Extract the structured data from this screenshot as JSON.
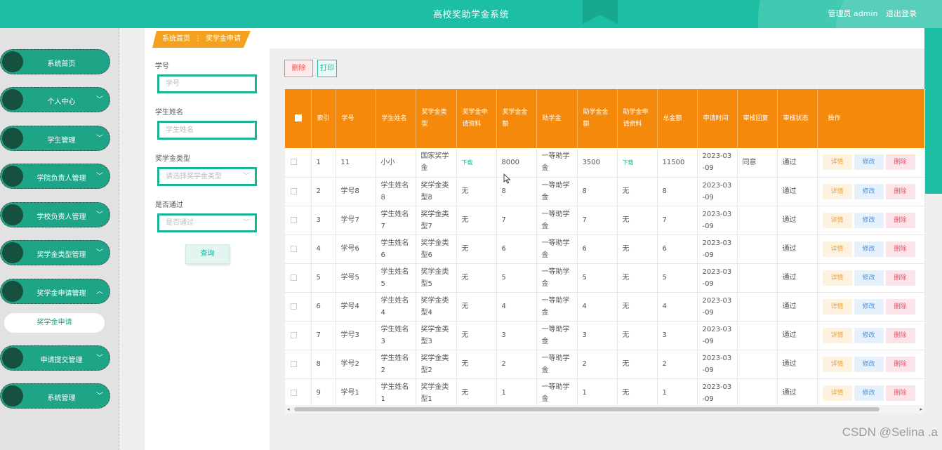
{
  "header": {
    "title": "高校奖助学金系统",
    "user": "管理员 admin",
    "logout": "退出登录"
  },
  "sidebar": {
    "items": [
      {
        "label": "系统首页",
        "chevron": ""
      },
      {
        "label": "个人中心",
        "chevron": "﹀"
      },
      {
        "label": "学生管理",
        "chevron": "﹀"
      },
      {
        "label": "学院负责人管理",
        "chevron": "﹀"
      },
      {
        "label": "学校负责人管理",
        "chevron": "﹀"
      },
      {
        "label": "奖学金类型管理",
        "chevron": "﹀"
      },
      {
        "label": "奖学金申请管理",
        "chevron": "︿"
      },
      {
        "label": "申请提交管理",
        "chevron": "﹀"
      },
      {
        "label": "系统管理",
        "chevron": "﹀"
      }
    ],
    "submenu": "奖学金申请"
  },
  "breadcrumb": {
    "home": "系统首页",
    "sep": "⋮",
    "current": "奖学金申请"
  },
  "search": {
    "student_no_label": "学号",
    "student_no_placeholder": "学号",
    "student_name_label": "学生姓名",
    "student_name_placeholder": "学生姓名",
    "type_label": "奖学金类型",
    "type_placeholder": "请选择奖学金类型",
    "pass_label": "是否通过",
    "pass_placeholder": "是否通过",
    "query_button": "查询"
  },
  "toolbar": {
    "delete": "删除",
    "print": "打印"
  },
  "table": {
    "headers": [
      "索引",
      "学号",
      "学生姓名",
      "奖学金类型",
      "奖学金申请资料",
      "奖学金金额",
      "助学金",
      "助学金金额",
      "助学金申请资料",
      "总金额",
      "申请时间",
      "审核回复",
      "审核状态",
      "操作"
    ],
    "ops": {
      "detail": "详情",
      "edit": "修改",
      "delete": "删除"
    },
    "rows": [
      {
        "idx": "1",
        "no": "11",
        "name": "小小",
        "type": "国家奖学金",
        "file": "下载",
        "amount": "8000",
        "grant": "一等助学金",
        "grant_amount": "3500",
        "grant_file": "下载",
        "total": "11500",
        "time": "2023-03-09",
        "reply": "同意",
        "status": "通过"
      },
      {
        "idx": "2",
        "no": "学号8",
        "name": "学生姓名8",
        "type": "奖学金类型8",
        "file": "无",
        "amount": "8",
        "grant": "一等助学金",
        "grant_amount": "8",
        "grant_file": "无",
        "total": "8",
        "time": "2023-03-09",
        "reply": "",
        "status": "通过"
      },
      {
        "idx": "3",
        "no": "学号7",
        "name": "学生姓名7",
        "type": "奖学金类型7",
        "file": "无",
        "amount": "7",
        "grant": "一等助学金",
        "grant_amount": "7",
        "grant_file": "无",
        "total": "7",
        "time": "2023-03-09",
        "reply": "",
        "status": "通过"
      },
      {
        "idx": "4",
        "no": "学号6",
        "name": "学生姓名6",
        "type": "奖学金类型6",
        "file": "无",
        "amount": "6",
        "grant": "一等助学金",
        "grant_amount": "6",
        "grant_file": "无",
        "total": "6",
        "time": "2023-03-09",
        "reply": "",
        "status": "通过"
      },
      {
        "idx": "5",
        "no": "学号5",
        "name": "学生姓名5",
        "type": "奖学金类型5",
        "file": "无",
        "amount": "5",
        "grant": "一等助学金",
        "grant_amount": "5",
        "grant_file": "无",
        "total": "5",
        "time": "2023-03-09",
        "reply": "",
        "status": "通过"
      },
      {
        "idx": "6",
        "no": "学号4",
        "name": "学生姓名4",
        "type": "奖学金类型4",
        "file": "无",
        "amount": "4",
        "grant": "一等助学金",
        "grant_amount": "4",
        "grant_file": "无",
        "total": "4",
        "time": "2023-03-09",
        "reply": "",
        "status": "通过"
      },
      {
        "idx": "7",
        "no": "学号3",
        "name": "学生姓名3",
        "type": "奖学金类型3",
        "file": "无",
        "amount": "3",
        "grant": "一等助学金",
        "grant_amount": "3",
        "grant_file": "无",
        "total": "3",
        "time": "2023-03-09",
        "reply": "",
        "status": "通过"
      },
      {
        "idx": "8",
        "no": "学号2",
        "name": "学生姓名2",
        "type": "奖学金类型2",
        "file": "无",
        "amount": "2",
        "grant": "一等助学金",
        "grant_amount": "2",
        "grant_file": "无",
        "total": "2",
        "time": "2023-03-09",
        "reply": "",
        "status": "通过"
      },
      {
        "idx": "9",
        "no": "学号1",
        "name": "学生姓名1",
        "type": "奖学金类型1",
        "file": "无",
        "amount": "1",
        "grant": "一等助学金",
        "grant_amount": "1",
        "grant_file": "无",
        "total": "1",
        "time": "2023-03-09",
        "reply": "",
        "status": "通过"
      }
    ]
  },
  "watermark": "CSDN @Selina .a",
  "colors": {
    "teal": "#1dbfa4",
    "orange": "#f5890c",
    "crumb": "#f4a21d"
  }
}
